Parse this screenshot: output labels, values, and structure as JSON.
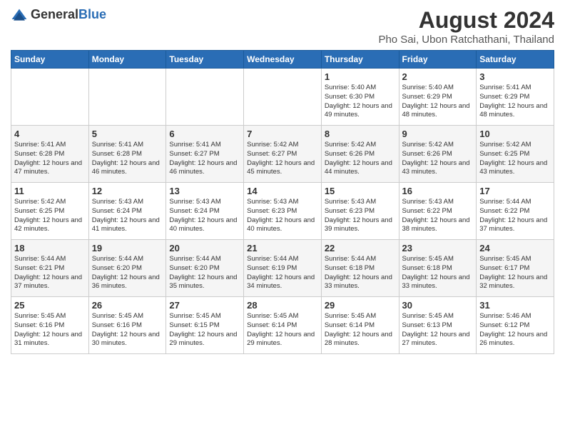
{
  "logo": {
    "general": "General",
    "blue": "Blue"
  },
  "title": "August 2024",
  "subtitle": "Pho Sai, Ubon Ratchathani, Thailand",
  "days_of_week": [
    "Sunday",
    "Monday",
    "Tuesday",
    "Wednesday",
    "Thursday",
    "Friday",
    "Saturday"
  ],
  "weeks": [
    [
      {
        "day": "",
        "info": ""
      },
      {
        "day": "",
        "info": ""
      },
      {
        "day": "",
        "info": ""
      },
      {
        "day": "",
        "info": ""
      },
      {
        "day": "1",
        "info": "Sunrise: 5:40 AM\nSunset: 6:30 PM\nDaylight: 12 hours\nand 49 minutes."
      },
      {
        "day": "2",
        "info": "Sunrise: 5:40 AM\nSunset: 6:29 PM\nDaylight: 12 hours\nand 48 minutes."
      },
      {
        "day": "3",
        "info": "Sunrise: 5:41 AM\nSunset: 6:29 PM\nDaylight: 12 hours\nand 48 minutes."
      }
    ],
    [
      {
        "day": "4",
        "info": "Sunrise: 5:41 AM\nSunset: 6:28 PM\nDaylight: 12 hours\nand 47 minutes."
      },
      {
        "day": "5",
        "info": "Sunrise: 5:41 AM\nSunset: 6:28 PM\nDaylight: 12 hours\nand 46 minutes."
      },
      {
        "day": "6",
        "info": "Sunrise: 5:41 AM\nSunset: 6:27 PM\nDaylight: 12 hours\nand 46 minutes."
      },
      {
        "day": "7",
        "info": "Sunrise: 5:42 AM\nSunset: 6:27 PM\nDaylight: 12 hours\nand 45 minutes."
      },
      {
        "day": "8",
        "info": "Sunrise: 5:42 AM\nSunset: 6:26 PM\nDaylight: 12 hours\nand 44 minutes."
      },
      {
        "day": "9",
        "info": "Sunrise: 5:42 AM\nSunset: 6:26 PM\nDaylight: 12 hours\nand 43 minutes."
      },
      {
        "day": "10",
        "info": "Sunrise: 5:42 AM\nSunset: 6:25 PM\nDaylight: 12 hours\nand 43 minutes."
      }
    ],
    [
      {
        "day": "11",
        "info": "Sunrise: 5:42 AM\nSunset: 6:25 PM\nDaylight: 12 hours\nand 42 minutes."
      },
      {
        "day": "12",
        "info": "Sunrise: 5:43 AM\nSunset: 6:24 PM\nDaylight: 12 hours\nand 41 minutes."
      },
      {
        "day": "13",
        "info": "Sunrise: 5:43 AM\nSunset: 6:24 PM\nDaylight: 12 hours\nand 40 minutes."
      },
      {
        "day": "14",
        "info": "Sunrise: 5:43 AM\nSunset: 6:23 PM\nDaylight: 12 hours\nand 40 minutes."
      },
      {
        "day": "15",
        "info": "Sunrise: 5:43 AM\nSunset: 6:23 PM\nDaylight: 12 hours\nand 39 minutes."
      },
      {
        "day": "16",
        "info": "Sunrise: 5:43 AM\nSunset: 6:22 PM\nDaylight: 12 hours\nand 38 minutes."
      },
      {
        "day": "17",
        "info": "Sunrise: 5:44 AM\nSunset: 6:22 PM\nDaylight: 12 hours\nand 37 minutes."
      }
    ],
    [
      {
        "day": "18",
        "info": "Sunrise: 5:44 AM\nSunset: 6:21 PM\nDaylight: 12 hours\nand 37 minutes."
      },
      {
        "day": "19",
        "info": "Sunrise: 5:44 AM\nSunset: 6:20 PM\nDaylight: 12 hours\nand 36 minutes."
      },
      {
        "day": "20",
        "info": "Sunrise: 5:44 AM\nSunset: 6:20 PM\nDaylight: 12 hours\nand 35 minutes."
      },
      {
        "day": "21",
        "info": "Sunrise: 5:44 AM\nSunset: 6:19 PM\nDaylight: 12 hours\nand 34 minutes."
      },
      {
        "day": "22",
        "info": "Sunrise: 5:44 AM\nSunset: 6:18 PM\nDaylight: 12 hours\nand 33 minutes."
      },
      {
        "day": "23",
        "info": "Sunrise: 5:45 AM\nSunset: 6:18 PM\nDaylight: 12 hours\nand 33 minutes."
      },
      {
        "day": "24",
        "info": "Sunrise: 5:45 AM\nSunset: 6:17 PM\nDaylight: 12 hours\nand 32 minutes."
      }
    ],
    [
      {
        "day": "25",
        "info": "Sunrise: 5:45 AM\nSunset: 6:16 PM\nDaylight: 12 hours\nand 31 minutes."
      },
      {
        "day": "26",
        "info": "Sunrise: 5:45 AM\nSunset: 6:16 PM\nDaylight: 12 hours\nand 30 minutes."
      },
      {
        "day": "27",
        "info": "Sunrise: 5:45 AM\nSunset: 6:15 PM\nDaylight: 12 hours\nand 29 minutes."
      },
      {
        "day": "28",
        "info": "Sunrise: 5:45 AM\nSunset: 6:14 PM\nDaylight: 12 hours\nand 29 minutes."
      },
      {
        "day": "29",
        "info": "Sunrise: 5:45 AM\nSunset: 6:14 PM\nDaylight: 12 hours\nand 28 minutes."
      },
      {
        "day": "30",
        "info": "Sunrise: 5:45 AM\nSunset: 6:13 PM\nDaylight: 12 hours\nand 27 minutes."
      },
      {
        "day": "31",
        "info": "Sunrise: 5:46 AM\nSunset: 6:12 PM\nDaylight: 12 hours\nand 26 minutes."
      }
    ]
  ]
}
